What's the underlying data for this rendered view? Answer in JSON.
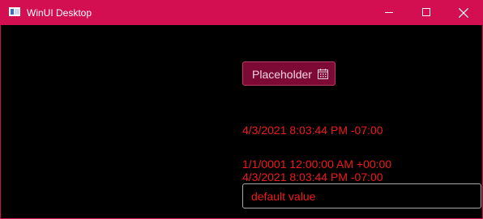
{
  "window": {
    "title": "WinUI Desktop",
    "accent_color": "#d30f52",
    "background_color": "#000000"
  },
  "controls": {
    "minimize_icon": "minimize-icon",
    "maximize_icon": "maximize-icon",
    "close_icon": "close-icon"
  },
  "date_picker": {
    "placeholder": "Placeholder",
    "icon": "calendar-icon"
  },
  "content": {
    "line1": "4/3/2021 8:03:44 PM -07:00",
    "line2": "1/1/0001 12:00:00 AM +00:00",
    "line3": "4/3/2021 8:03:44 PM -07:00"
  },
  "textbox": {
    "value": "default value",
    "text_color": "#f01a1a"
  }
}
